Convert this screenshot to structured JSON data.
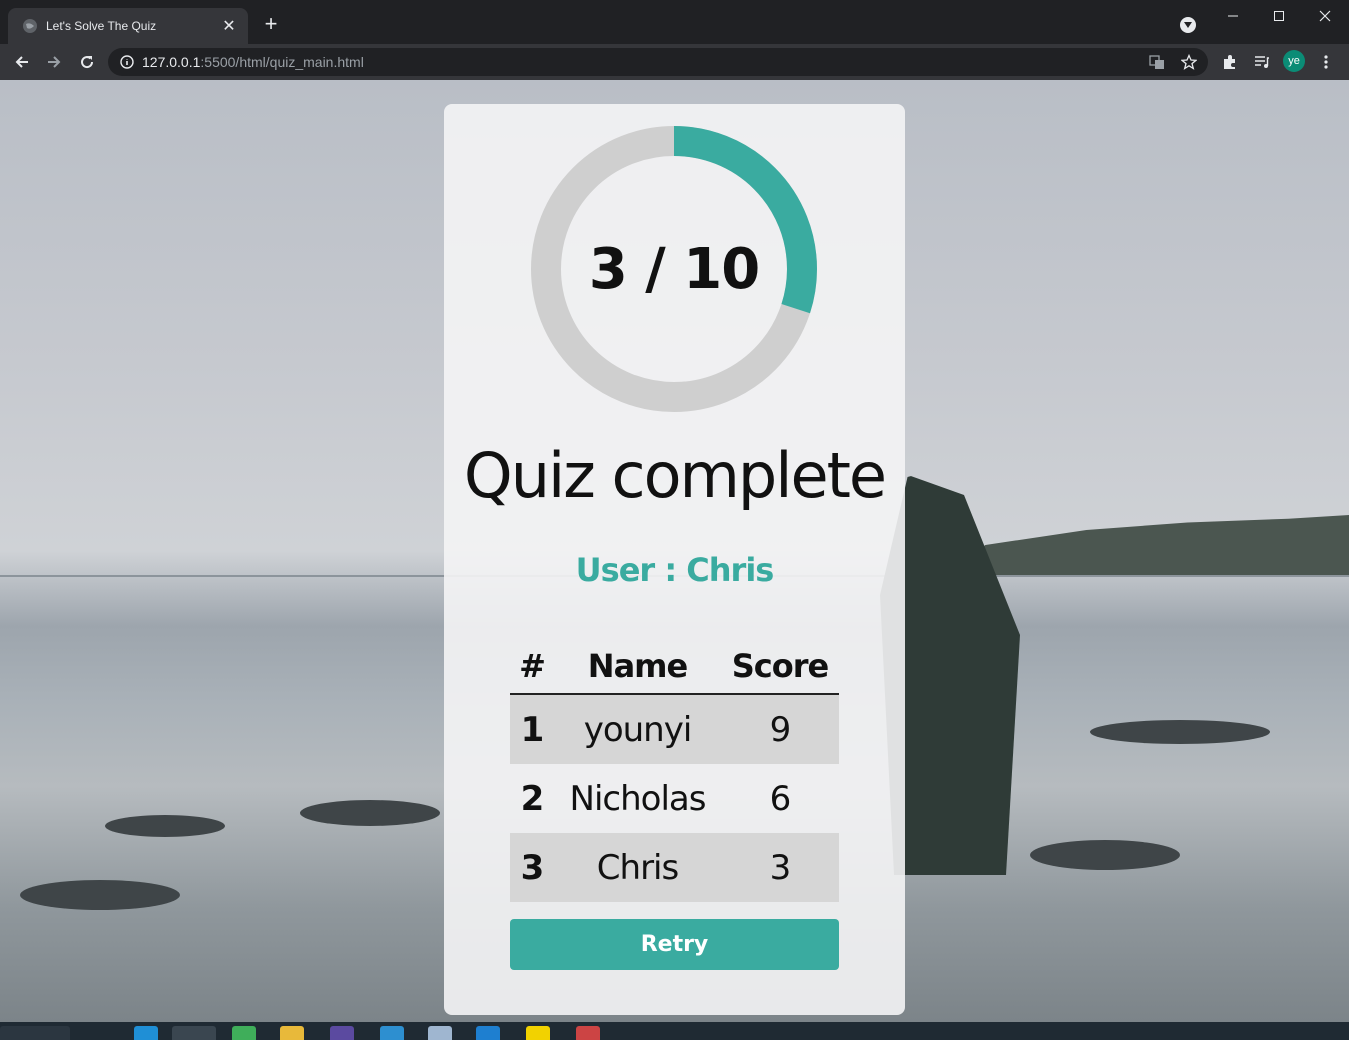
{
  "browser": {
    "tab_title": "Let's Solve The Quiz",
    "url_host": "127.0.0.1",
    "url_path": ":5500/html/quiz_main.html",
    "profile_initials": "ye"
  },
  "quiz": {
    "score_text": "3 / 10",
    "score": 3,
    "total": 10,
    "title": "Quiz complete",
    "user_text": "User : Chris",
    "accent_color": "#3aaba0",
    "ring_track_color": "#cfcfcf"
  },
  "leaderboard": {
    "headers": {
      "rank": "#",
      "name": "Name",
      "score": "Score"
    },
    "rows": [
      {
        "rank": "1",
        "name": "younyi",
        "score": "9"
      },
      {
        "rank": "2",
        "name": "Nicholas",
        "score": "6"
      },
      {
        "rank": "3",
        "name": "Chris",
        "score": "3"
      }
    ]
  },
  "actions": {
    "retry_label": "Retry"
  }
}
